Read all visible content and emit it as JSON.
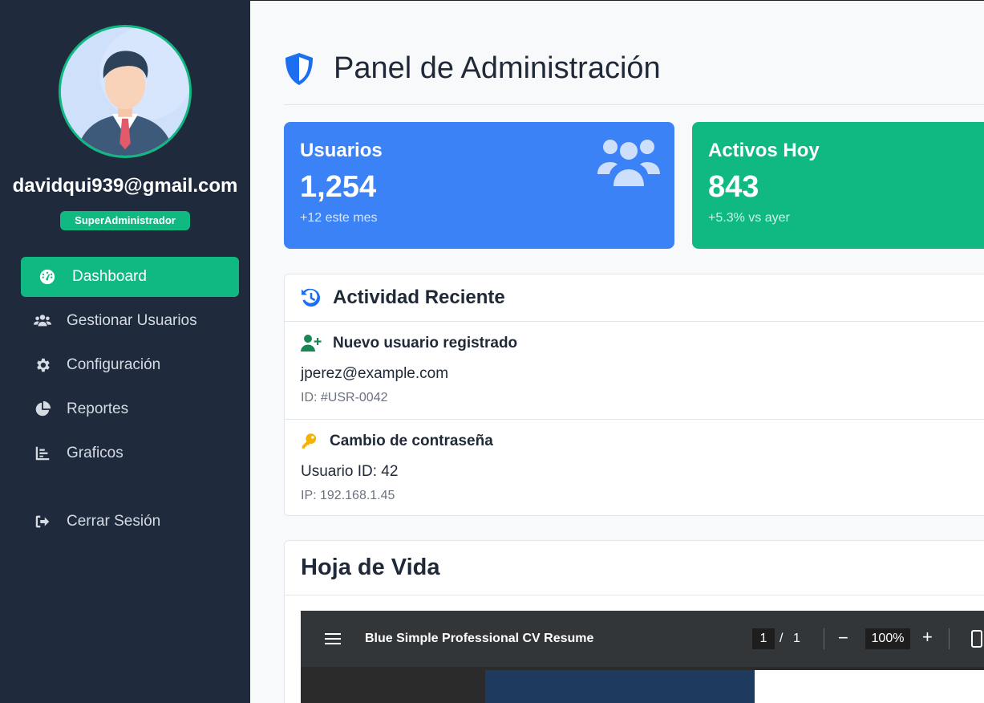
{
  "sidebar": {
    "user_email": "davidqui939@gmail.com",
    "role": "SuperAdministrador",
    "items": [
      {
        "label": "Dashboard",
        "icon": "gauge-icon",
        "active": true
      },
      {
        "label": "Gestionar Usuarios",
        "icon": "users-icon",
        "active": false
      },
      {
        "label": "Configuración",
        "icon": "gear-icon",
        "active": false
      },
      {
        "label": "Reportes",
        "icon": "pie-chart-icon",
        "active": false
      },
      {
        "label": "Graficos",
        "icon": "bar-chart-icon",
        "active": false
      }
    ],
    "logout_label": "Cerrar Sesión"
  },
  "header": {
    "title": "Panel de Administración",
    "icon": "shield-icon"
  },
  "stats": [
    {
      "label": "Usuarios",
      "value": "1,254",
      "sub": "+12 este mes",
      "color": "#3b82f6",
      "icon": "users-icon"
    },
    {
      "label": "Activos Hoy",
      "value": "843",
      "sub": "+5.3% vs ayer",
      "color": "#10b981"
    }
  ],
  "activity": {
    "title": "Actividad Reciente",
    "icon": "history-icon",
    "items": [
      {
        "title": "Nuevo usuario registrado",
        "line": "jperez@example.com",
        "meta": "ID: #USR-0042",
        "icon": "user-plus-icon"
      },
      {
        "title": "Cambio de contraseña",
        "line": "Usuario ID: 42",
        "meta": "IP: 192.168.1.45",
        "icon": "key-icon"
      }
    ]
  },
  "cv": {
    "title": "Hoja de Vida",
    "viewer": {
      "doc_title": "Blue Simple Professional CV Resume",
      "page": "1",
      "separator": "/",
      "total_pages": "1",
      "zoom": "100%"
    }
  },
  "colors": {
    "sidebar_bg": "#1f2a3d",
    "accent_green": "#10b981",
    "accent_blue": "#3b82f6"
  }
}
